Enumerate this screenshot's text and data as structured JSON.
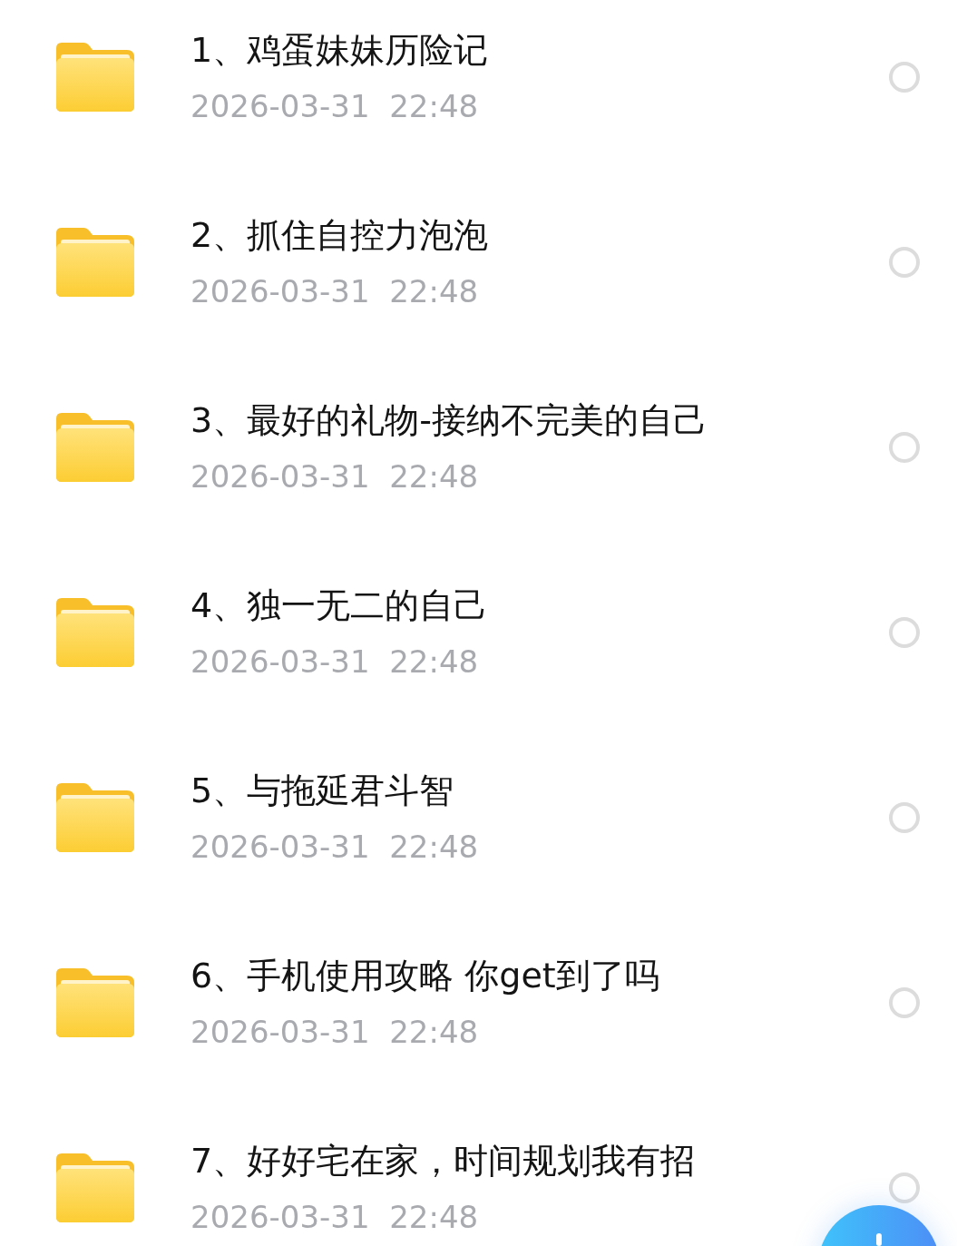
{
  "files": [
    {
      "kind": "folder",
      "name": "1、鸡蛋妹妹历险记",
      "date": "2026-03-31  22:48",
      "selected": false
    },
    {
      "kind": "folder",
      "name": "2、抓住自控力泡泡",
      "date": "2026-03-31  22:48",
      "selected": false
    },
    {
      "kind": "folder",
      "name": "3、最好的礼物-接纳不完美的自己",
      "date": "2026-03-31  22:48",
      "selected": false
    },
    {
      "kind": "folder",
      "name": "4、独一无二的自己",
      "date": "2026-03-31  22:48",
      "selected": false
    },
    {
      "kind": "folder",
      "name": "5、与拖延君斗智",
      "date": "2026-03-31  22:48",
      "selected": false
    },
    {
      "kind": "folder",
      "name": "6、手机使用攻略 你get到了吗",
      "date": "2026-03-31  22:48",
      "selected": false
    },
    {
      "kind": "folder",
      "name": "7、好好宅在家，时间规划我有招",
      "date": "2026-03-31  22:48",
      "selected": false
    }
  ]
}
